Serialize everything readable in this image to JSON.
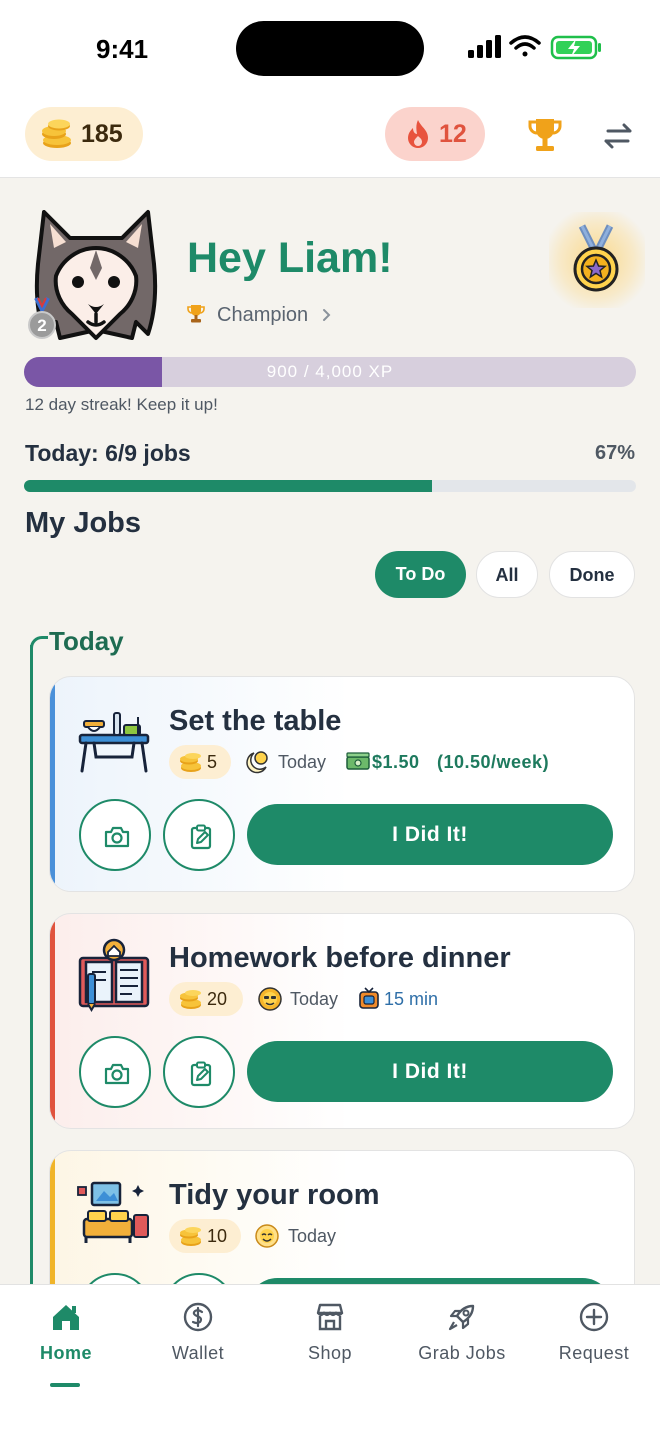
{
  "status_bar": {
    "time": "9:41"
  },
  "header": {
    "coins": "185",
    "streak_count": "12",
    "coin_icon": "coin-stack-icon",
    "fire_icon": "flame-icon",
    "trophy_icon": "trophy-icon",
    "swap_icon": "swap-arrows-icon"
  },
  "profile": {
    "greeting": "Hey Liam!",
    "rank_number": "2",
    "title": "Champion",
    "xp_text": "900 / 4,000 XP",
    "xp_progress": 0.225,
    "streak_message": "12 day streak! Keep it up!"
  },
  "today": {
    "label": "Today: 6/9 jobs",
    "percent_label": "67%",
    "progress": 0.667
  },
  "jobs_section": {
    "title": "My Jobs",
    "filters": [
      "To Do",
      "All",
      "Done"
    ],
    "active_filter": "To Do",
    "day_label": "Today"
  },
  "jobs": [
    {
      "title": "Set the table",
      "coins": "5",
      "schedule": "Today",
      "money": "$1.50",
      "weekly": "(10.50/week)",
      "button": "I Did It!",
      "accent": "#4a90d9"
    },
    {
      "title": "Homework before dinner",
      "coins": "20",
      "schedule": "Today",
      "duration": "15 min",
      "button": "I Did It!",
      "accent": "#e0533e"
    },
    {
      "title": "Tidy your room",
      "coins": "10",
      "schedule": "Today",
      "accent": "#f0b429"
    }
  ],
  "nav": {
    "items": [
      "Home",
      "Wallet",
      "Shop",
      "Grab Jobs",
      "Request"
    ],
    "active": "Home"
  },
  "colors": {
    "primary": "#1e8a68",
    "xp": "#7a56a6",
    "coin_bg": "#fdeed2",
    "fire_bg": "#fbd3cc"
  }
}
